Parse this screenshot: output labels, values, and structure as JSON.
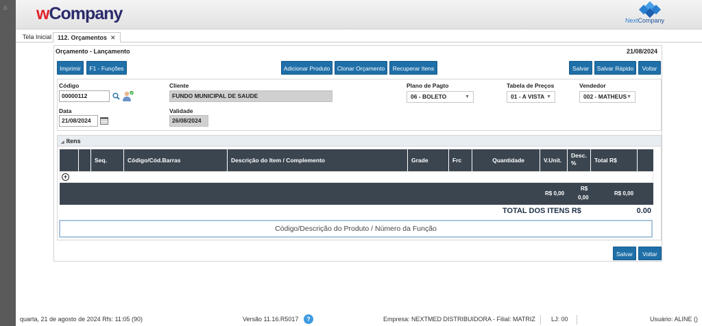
{
  "header": {
    "logo_w": "w",
    "logo_rest": "Company",
    "brand_prefix": "Next",
    "brand_suffix": "Company"
  },
  "tabs": [
    {
      "label": "Tela Inicial"
    },
    {
      "label": "112. Orçamentos",
      "close": "✕"
    }
  ],
  "panel": {
    "title": "Orçamento - Lançamento",
    "date": "21/08/2024"
  },
  "toolbar": {
    "print": "Imprimir",
    "functions": "F1 - Funções",
    "add_product": "Adicionar Produto",
    "clone": "Clonar Orçamento",
    "recover": "Recuperar Itens",
    "save": "Salvar",
    "quick_save": "Salvar Rápido",
    "back": "Voltar"
  },
  "form": {
    "code_label": "Código",
    "code_value": "00000112",
    "client_label": "Cliente",
    "client_value": "FUNDO MUNICIPAL DE SAUDE",
    "payment_label": "Plano de Pagto",
    "payment_value": "06 - BOLETO",
    "price_label": "Tabela de Preços",
    "price_value": "01 - A VISTA",
    "seller_label": "Vendedor",
    "seller_value": "002 - MATHEUS",
    "date_label": "Data",
    "date_value": "21/08/2024",
    "validity_label": "Validade",
    "validity_value": "26/08/2024"
  },
  "items": {
    "section_title": "Itens",
    "columns": [
      "Seq.",
      "Código/Cód.Barras",
      "Descrição do Item / Complemento",
      "Grade",
      "Frc",
      "Quantidade",
      "V.Unit.",
      "Desc. %",
      "Total R$"
    ],
    "footer": {
      "vunit": "R$ 0,00",
      "desc_top": "R$",
      "desc_bottom": "0,00",
      "total": "R$ 0,00"
    },
    "total_label": "TOTAL DOS ITENS R$",
    "total_value": "0.00",
    "search_placeholder": "Código/Descrição do Produto / Número da Função"
  },
  "bottom": {
    "save": "Salvar",
    "back": "Voltar"
  },
  "status": {
    "date_time": "quarta, 21 de agosto de 2024  Rfs: 11:05 (90)",
    "version": "Versão 11.16.R5017",
    "help": "?",
    "company": "Empresa: NEXTMED DISTRIBUIDORA - Filial: MATRIZ",
    "lj": "LJ: 00",
    "user": "Usuário: ALINE ()"
  }
}
